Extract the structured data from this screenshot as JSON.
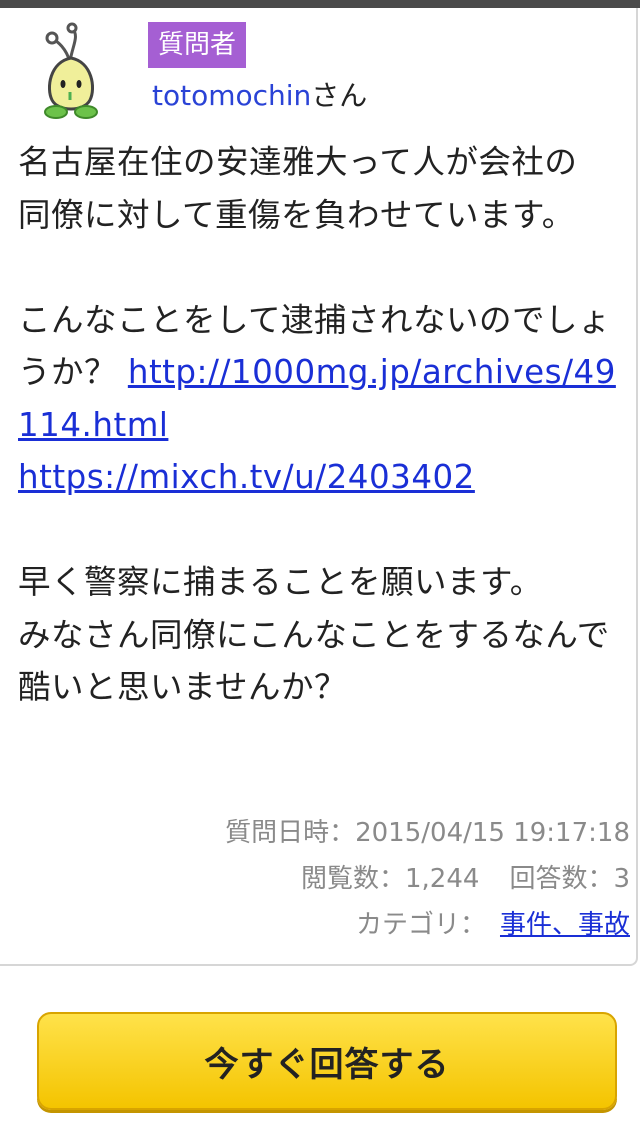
{
  "questioner": {
    "badge": "質問者",
    "username": "totomochin",
    "honorific": "さん",
    "avatar_icon": "sprout-character-icon"
  },
  "question": {
    "paragraph1_line1": "名古屋在住の安達雅大って人が会社の",
    "paragraph1_line2": "同僚に対して重傷を負わせています。",
    "paragraph2_text": "こんなことをして逮捕されないのでしょうか？ ",
    "link1": "http://1000mg.jp/archives/49114.html",
    "link2": "https://mixch.tv/u/2403402",
    "paragraph3_line1": "早く警察に捕まることを願います。",
    "paragraph3_line2": "みなさん同僚にこんなことをするなんで酷いと思いませんか？"
  },
  "meta": {
    "date_label": "質問日時：",
    "date_value": "2015/04/15 19:17:18",
    "views_label": "閲覧数：",
    "views_value": "1,244",
    "answers_label": "回答数：",
    "answers_value": "3",
    "category_label": "カテゴリ：",
    "category_value": "事件、事故"
  },
  "actions": {
    "answer_button": "今すぐ回答する"
  },
  "colors": {
    "badge": "#a55fd3",
    "link": "#1a2fd6",
    "button": "#f4c400",
    "meta_text": "#8a8a8a"
  }
}
